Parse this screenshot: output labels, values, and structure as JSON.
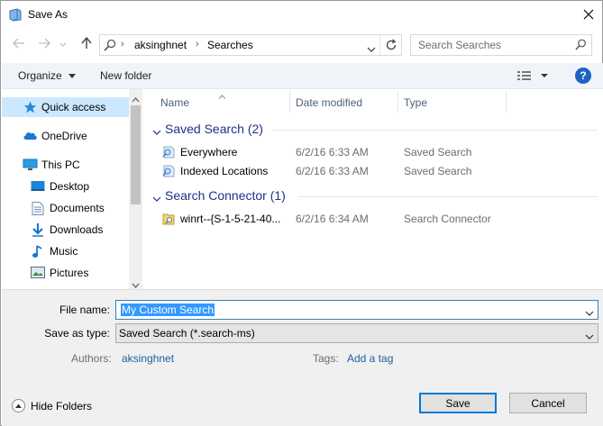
{
  "window": {
    "title": "Save As",
    "icon": "save-as-app-icon",
    "close_icon": "close-icon"
  },
  "navigation": {
    "back_icon": "back-arrow-icon",
    "forward_icon": "forward-arrow-icon",
    "recent_icon": "recent-locations-chevron-icon",
    "up_icon": "up-arrow-icon",
    "address": {
      "segments": [
        "aksinghnet",
        "Searches"
      ],
      "refresh_icon": "refresh-icon"
    },
    "search": {
      "placeholder": "Search Searches",
      "icon": "search-icon"
    }
  },
  "toolbar": {
    "organize_label": "Organize",
    "new_folder_label": "New folder",
    "view_icon": "view-options-icon",
    "help_label": "?"
  },
  "nav_pane": {
    "items": [
      {
        "label": "Quick access",
        "icon": "star-icon",
        "selected": true
      },
      {
        "label": "OneDrive",
        "icon": "onedrive-cloud-icon"
      },
      {
        "label": "This PC",
        "icon": "computer-icon"
      },
      {
        "label": "Desktop",
        "icon": "desktop-folder-icon"
      },
      {
        "label": "Documents",
        "icon": "documents-folder-icon"
      },
      {
        "label": "Downloads",
        "icon": "downloads-folder-icon"
      },
      {
        "label": "Music",
        "icon": "music-folder-icon"
      },
      {
        "label": "Pictures",
        "icon": "pictures-folder-icon"
      }
    ]
  },
  "file_list": {
    "columns": [
      "Name",
      "Date modified",
      "Type"
    ],
    "groups": [
      {
        "label": "Saved Search (2)",
        "rows": [
          {
            "name": "Everywhere",
            "date": "6/2/16 6:33 AM",
            "type": "Saved Search",
            "icon": "saved-search-icon"
          },
          {
            "name": "Indexed Locations",
            "date": "6/2/16 6:33 AM",
            "type": "Saved Search",
            "icon": "saved-search-icon"
          }
        ]
      },
      {
        "label": "Search Connector (1)",
        "rows": [
          {
            "name": "winrt--{S-1-5-21-40...",
            "date": "6/2/16 6:34 AM",
            "type": "Search Connector",
            "icon": "search-connector-icon"
          }
        ]
      }
    ]
  },
  "form": {
    "file_name_label": "File name:",
    "file_name_value": "My Custom Search",
    "save_type_label": "Save as type:",
    "save_type_value": "Saved Search (*.search-ms)",
    "authors_label": "Authors:",
    "authors_value": "aksinghnet",
    "tags_label": "Tags:",
    "tags_value": "Add a tag"
  },
  "footer": {
    "hide_folders_label": "Hide Folders",
    "save_label": "Save",
    "cancel_label": "Cancel"
  },
  "colors": {
    "selection": "#cce8ff",
    "accent": "#0078d7",
    "group_header": "#1e3287",
    "link": "#1f5f9e",
    "text_selection": "#3399ff"
  }
}
